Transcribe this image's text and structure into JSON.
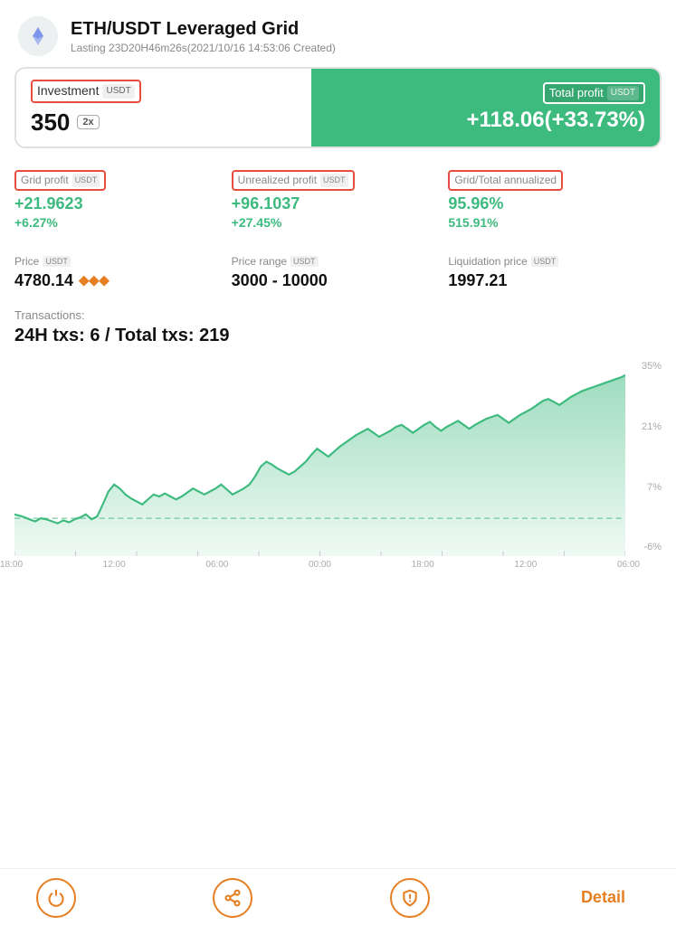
{
  "header": {
    "title": "ETH/USDT Leveraged Grid",
    "subtitle": "Lasting 23D20H46m26s(2021/10/16 14:53:06 Created)"
  },
  "summary": {
    "investment_label": "Investment",
    "investment_currency": "USDT",
    "investment_value": "350",
    "leverage": "2x",
    "total_profit_label": "Total profit",
    "total_profit_currency": "USDT",
    "total_profit_value": "+118.06(+33.73%)"
  },
  "stats": {
    "grid_profit": {
      "label": "Grid profit",
      "currency": "USDT",
      "value": "+21.9623",
      "pct": "+6.27%"
    },
    "unrealized_profit": {
      "label": "Unrealized profit",
      "currency": "USDT",
      "value": "+96.1037",
      "pct": "+27.45%"
    },
    "annualized": {
      "label": "Grid/Total annualized",
      "value1": "95.96%",
      "value2": "515.91%"
    }
  },
  "prices": {
    "price": {
      "label": "Price",
      "currency": "USDT",
      "value": "4780.14"
    },
    "range": {
      "label": "Price range",
      "currency": "USDT",
      "value": "3000 - 10000"
    },
    "liquidation": {
      "label": "Liquidation price",
      "currency": "USDT",
      "value": "1997.21"
    }
  },
  "transactions": {
    "label": "Transactions:",
    "value": "24H txs: 6 / Total txs: 219"
  },
  "chart": {
    "y_labels": [
      "35%",
      "21%",
      "7%",
      "-6%"
    ],
    "x_labels": [
      "18:00",
      "12:00",
      "06:00",
      "00:00",
      "18:00",
      "12:00",
      "06:00"
    ]
  },
  "nav": {
    "detail_label": "Detail"
  },
  "colors": {
    "green": "#3dba7e",
    "red_border": "#e74c3c",
    "orange": "#e67e22"
  }
}
